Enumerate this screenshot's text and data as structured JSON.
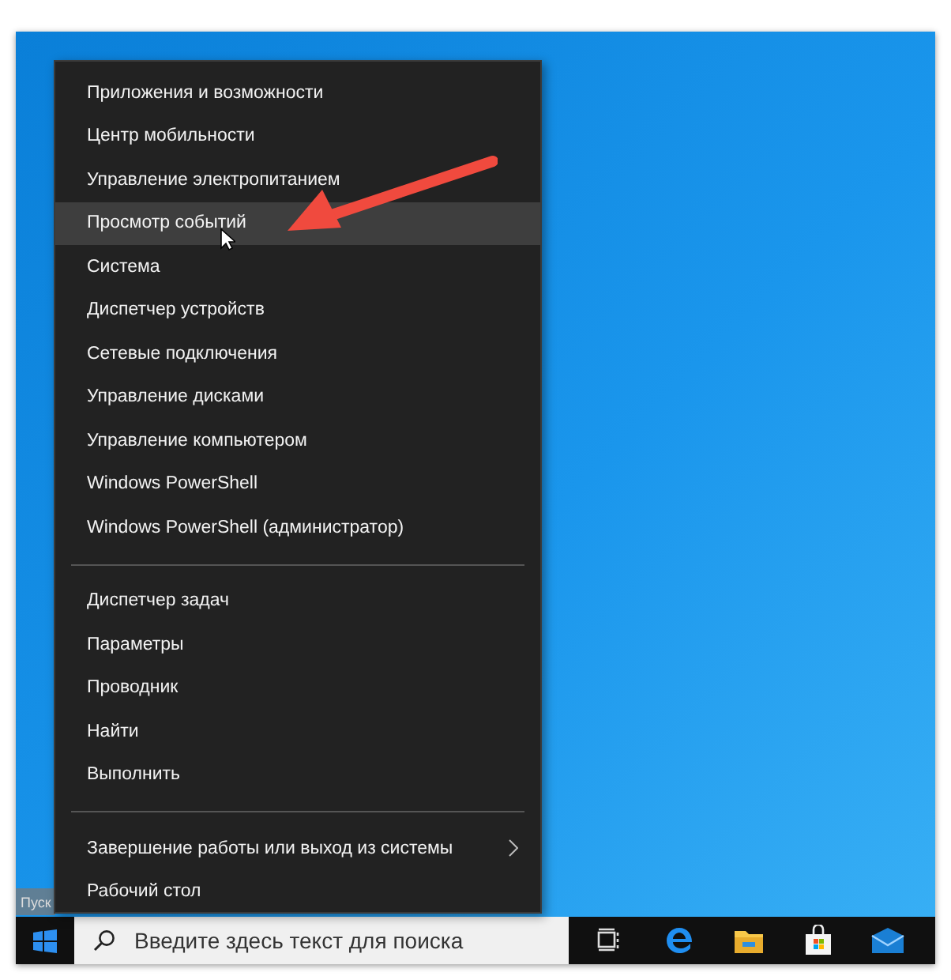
{
  "start_menu": {
    "groups": [
      {
        "items": [
          {
            "label": "Приложения и возможности",
            "selected": false
          },
          {
            "label": "Центр мобильности",
            "selected": false
          },
          {
            "label": "Управление электропитанием",
            "selected": false
          },
          {
            "label": "Просмотр событий",
            "selected": true
          },
          {
            "label": "Система",
            "selected": false
          },
          {
            "label": "Диспетчер устройств",
            "selected": false
          },
          {
            "label": "Сетевые подключения",
            "selected": false
          },
          {
            "label": "Управление дисками",
            "selected": false
          },
          {
            "label": "Управление компьютером",
            "selected": false
          },
          {
            "label": "Windows PowerShell",
            "selected": false
          },
          {
            "label": "Windows PowerShell (администратор)",
            "selected": false
          }
        ]
      },
      {
        "items": [
          {
            "label": "Диспетчер задач",
            "selected": false
          },
          {
            "label": "Параметры",
            "selected": false
          },
          {
            "label": "Проводник",
            "selected": false
          },
          {
            "label": "Найти",
            "selected": false
          },
          {
            "label": "Выполнить",
            "selected": false
          }
        ]
      },
      {
        "items": [
          {
            "label": "Завершение работы или выход из системы",
            "selected": false,
            "has_submenu": true
          },
          {
            "label": "Рабочий стол",
            "selected": false
          }
        ]
      }
    ]
  },
  "tooltip": "Пуск",
  "taskbar": {
    "search": {
      "placeholder": "Введите здесь текст для поиска"
    },
    "apps": [
      {
        "kind": "taskview"
      },
      {
        "kind": "edge"
      },
      {
        "kind": "explorer"
      },
      {
        "kind": "store"
      },
      {
        "kind": "mail"
      }
    ]
  }
}
